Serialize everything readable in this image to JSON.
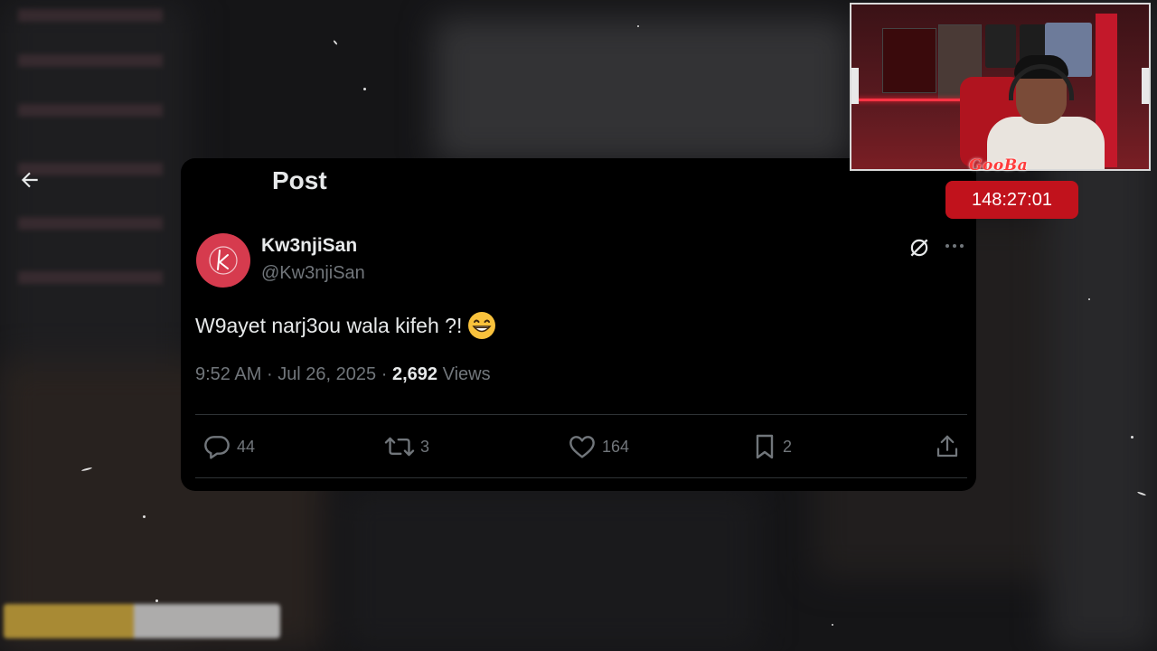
{
  "post": {
    "header_title": "Post",
    "author": {
      "name": "Kw3njiSan",
      "handle": "@Kw3njiSan",
      "avatar_letter": "k",
      "avatar_color": "#d63b4e"
    },
    "text": "W9ayet narj3ou wala kifeh ?!",
    "text_emoji": "grinning-face-with-smiling-eyes",
    "time": "9:52 AM",
    "date": "Jul 26, 2025",
    "views_count": "2,692",
    "views_label": "Views",
    "separator": "·",
    "actions": {
      "replies": "44",
      "reposts": "3",
      "likes": "164",
      "bookmarks": "2"
    }
  },
  "stream": {
    "timer": "148:27:01",
    "timer_color": "#c1121c",
    "webcam_logo": "GooBa"
  },
  "colors": {
    "card_bg": "#000000",
    "text_primary": "#e7e9ea",
    "text_secondary": "#71767b"
  }
}
